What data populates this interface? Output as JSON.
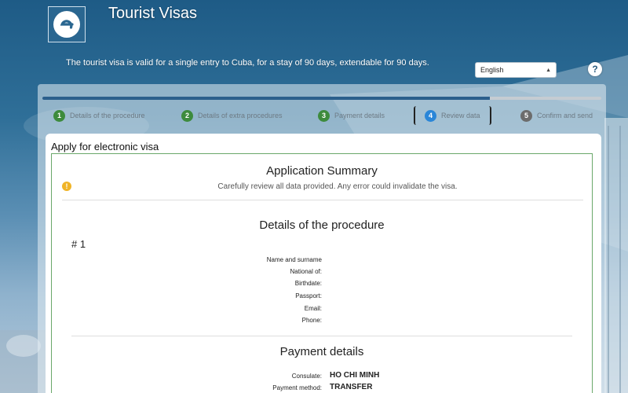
{
  "header": {
    "title": "Tourist Visas",
    "intro": "The tourist visa is valid for a single entry to Cuba, for a stay of 90 days, extendable for 90 days.",
    "language": "English",
    "help_label": "?"
  },
  "wizard": {
    "progress": 0.8,
    "steps": [
      {
        "num": "1",
        "label": "Details of the procedure",
        "state": "done"
      },
      {
        "num": "2",
        "label": "Details of extra procedures",
        "state": "done"
      },
      {
        "num": "3",
        "label": "Payment details",
        "state": "done"
      },
      {
        "num": "4",
        "label": "Review data",
        "state": "current"
      },
      {
        "num": "5",
        "label": "Confirm and send",
        "state": "todo"
      }
    ]
  },
  "form": {
    "title": "Apply for electronic visa",
    "summary_title": "Application Summary",
    "warning_icon": "!",
    "summary_subtitle": "Carefully review all data provided. Any error could invalidate the visa.",
    "procedure": {
      "title": "Details of the procedure",
      "item_number": "# 1",
      "fields": [
        {
          "label": "Name and surname",
          "value": ""
        },
        {
          "label": "National of:",
          "value": ""
        },
        {
          "label": "Birthdate:",
          "value": ""
        },
        {
          "label": "Passport:",
          "value": ""
        },
        {
          "label": "Email:",
          "value": ""
        },
        {
          "label": "Phone:",
          "value": ""
        }
      ]
    },
    "payment": {
      "title": "Payment details",
      "fields": [
        {
          "label": "Consulate:",
          "value": "HO CHI MINH"
        },
        {
          "label": "Payment method:",
          "value": "TRANSFER"
        }
      ]
    }
  },
  "colors": {
    "accent": "#2b5f8c",
    "step_done": "#3d8b3d",
    "step_current": "#2a86d8",
    "step_todo": "#6c6c6c",
    "summary_border": "#6aa86a",
    "warning": "#f0b428"
  }
}
